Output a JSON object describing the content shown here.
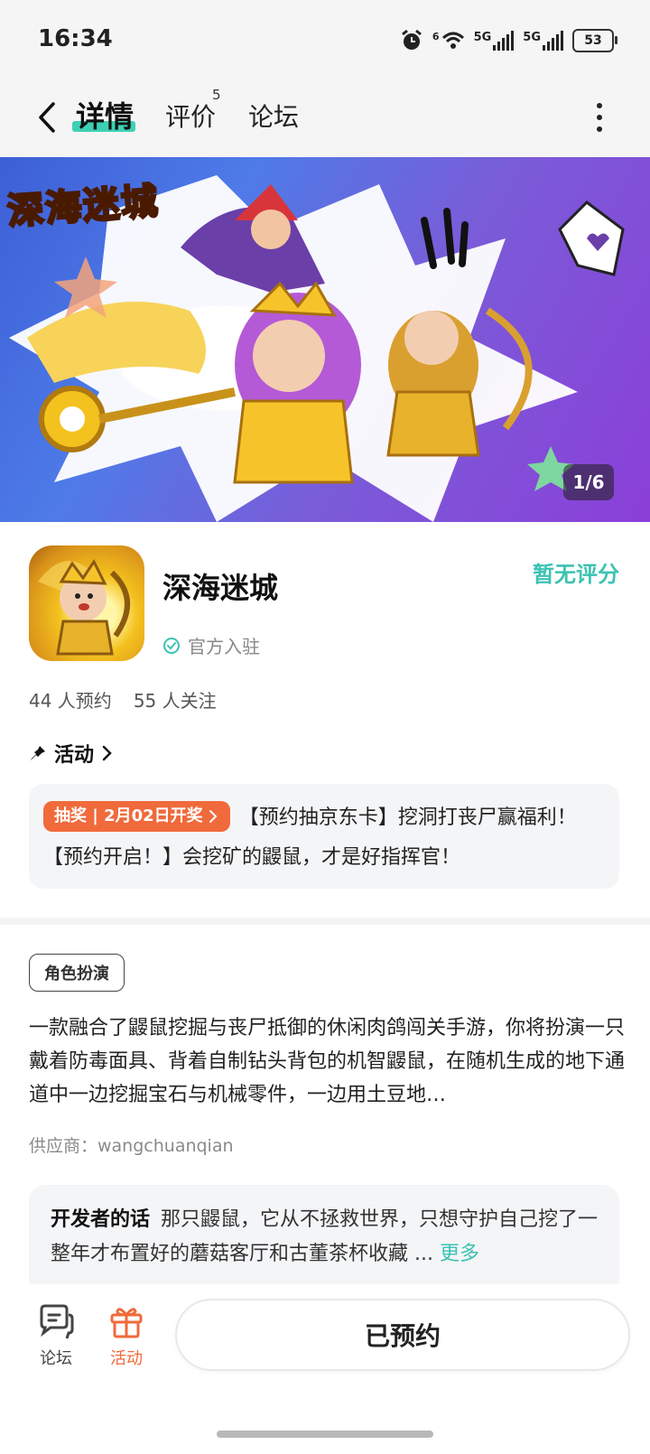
{
  "status_bar": {
    "time": "16:34",
    "signal1_label": "5G",
    "signal2_label": "5G",
    "wifi_badge": "6",
    "battery": "53"
  },
  "nav": {
    "tabs": [
      {
        "label": "详情",
        "active": true
      },
      {
        "label": "评价",
        "badge": "5"
      },
      {
        "label": "论坛"
      }
    ]
  },
  "banner": {
    "title": "深海迷城",
    "counter": "1/6"
  },
  "app": {
    "name": "深海迷城",
    "rating": "暂无评分",
    "official_label": "官方入驻",
    "reservations": "44 人预约",
    "followers": "55 人关注"
  },
  "activity": {
    "header": "活动",
    "pill": "抽奖 | 2月02日开奖",
    "text": "【预约抽京东卡】挖洞打丧尸赢福利！【预约开启！】会挖矿的鼹鼠，才是好指挥官！"
  },
  "genre_tag": "角色扮演",
  "description": "一款融合了鼹鼠挖掘与丧尸抵御的休闲肉鸽闯关手游，你将扮演一只戴着防毒面具、背着自制钻头背包的机智鼹鼠，在随机生成的地下通道中一边挖掘宝石与机械零件，一边用土豆地…",
  "supplier": "供应商：wangchuanqian",
  "developer": {
    "label": "开发者的话",
    "text": "那只鼹鼠，它从不拯救世界，只想守护自己挖了一整年才布置好的蘑菇客厅和古董茶杯收藏 ...",
    "more": "更多"
  },
  "bottom_bar": {
    "forum_label": "论坛",
    "activity_label": "活动",
    "reserved_label": "已预约"
  },
  "colors": {
    "accent": "#3cc2b2",
    "tab_underline": "#3dd0b4",
    "lottery": "#f06a3b",
    "activity_orange": "#f06a3b"
  }
}
